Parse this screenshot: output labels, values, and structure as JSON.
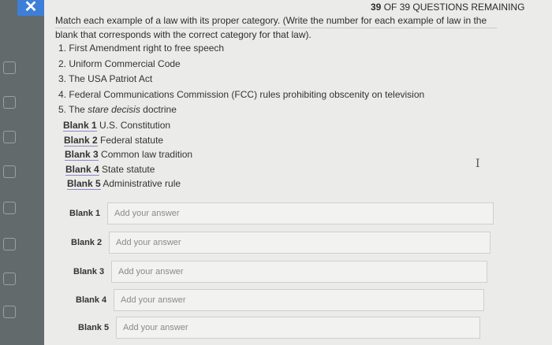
{
  "header": {
    "close_glyph": "✕",
    "counter_count": "39",
    "counter_text": "OF 39 QUESTIONS REMAINING"
  },
  "question": {
    "prompt_line1": "Match each example of a law with its proper category. (Write the number for each example of law in the",
    "prompt_line2": "blank that corresponds with the correct category for that law).",
    "items": [
      "1. First Amendment right to free speech",
      "2. Uniform Commercial Code",
      "3. The USA Patriot Act",
      "4. Federal Communications Commission (FCC) rules prohibiting obscenity on television"
    ],
    "item5_prefix": "5. The ",
    "item5_italic": "stare decisis",
    "item5_suffix": " doctrine",
    "blanks": [
      {
        "label": "Blank 1",
        "text": "U.S. Constitution"
      },
      {
        "label": "Blank 2",
        "text": "Federal statute"
      },
      {
        "label": "Blank 3",
        "text": "Common law tradition"
      },
      {
        "label": "Blank 4",
        "text": "State statute"
      },
      {
        "label": "Blank 5",
        "text": "Administrative rule"
      }
    ]
  },
  "answers": [
    {
      "label": "Blank 1",
      "placeholder": "Add your answer",
      "value": ""
    },
    {
      "label": "Blank 2",
      "placeholder": "Add your answer",
      "value": ""
    },
    {
      "label": "Blank 3",
      "placeholder": "Add your answer",
      "value": ""
    },
    {
      "label": "Blank 4",
      "placeholder": "Add your answer",
      "value": ""
    },
    {
      "label": "Blank 5",
      "placeholder": "Add your answer",
      "value": ""
    }
  ],
  "cursor_glyph": "I",
  "colors": {
    "accent": "#3d7fd8",
    "underline": "#8d86c9",
    "sidebar": "#626a6c"
  }
}
